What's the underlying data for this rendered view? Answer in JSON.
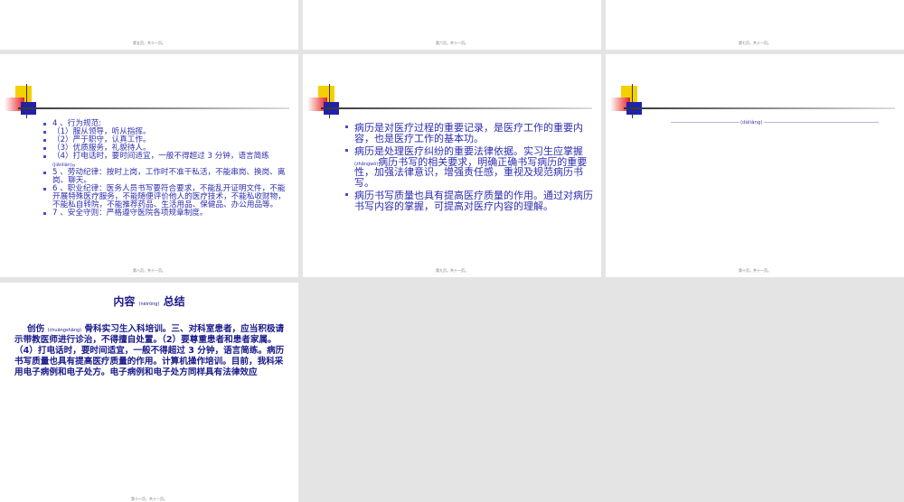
{
  "slides": [
    {
      "footer": "第五页，共十一页。"
    },
    {
      "footer": "第六页，共十一页。"
    },
    {
      "footer": "第七页，共十一页。"
    },
    {
      "footer": "第八页，共十一页。",
      "bullets": [
        "4 、行为规范:",
        "（1）服从领导，听从指挥。",
        "（2）严于职守，认真工作。",
        "（3）优质服务，礼貌待人。",
        "（4）打电话时，要时间适宜，一般不得超过 3 分钟，语言简练",
        "5 、劳动纪律：按时上岗，工作时不准干私活，不能串岗、换岗、离岗、聊天。",
        "6 、职业纪律：医务人员书写要符合要求，不能乱开证明文件，不能开展特殊医疗服务，不能随便评价他人的医疗技术，不能私收财物，不能私自转院，不能推荐药品、生活用品、保健品、办公用品等。",
        "7 、安全守则：严格遵守医院各项规章制度。"
      ],
      "pinyin": "(jiǎnliàn)",
      "tail": "。"
    },
    {
      "footer": "第九页，共十一页。",
      "bullets": [
        "病历是对医疗过程的重要记录，是医疗工作的重要内容，也是医疗工作的基本功。",
        "病历是处理医疗纠纷的重要法律依据。实习生应掌握",
        "病历书写质量也具有提高医疗质量的作用。通过对病历书写内容的掌握，可提高对医疗内容的理解。"
      ],
      "pinyin": "(zhǎngwò)",
      "b2_rest": "病历书写的相关要求，明确正确书写病历的重要性，加强法律意识，增强责任感，重视及规范病历书写。"
    },
    {
      "footer": "第十页，共十一页。",
      "tiny_text": "(dàliàng)"
    },
    {
      "footer": "第十一页，共十一页。",
      "title_a": "内容",
      "title_py": "(nèiróng)",
      "title_b": "总结",
      "body_a": "创伤",
      "body_py": "(chuāngshāng)",
      "body_b": "骨科实习生入科培训。三、对科室患者，应当积极请示带教医师进行诊治，不得擅自处置。（2）要尊重患者和患者家属。（4）打电话时，要时间适宜，一般不得超过 3 分钟，语言简练。病历书写质量也具有提高医疗质量的作用。计算机操作培训。目前，我科采用电子病例和电子处方。电子病例和电子处方同样具有法律效应"
    }
  ]
}
